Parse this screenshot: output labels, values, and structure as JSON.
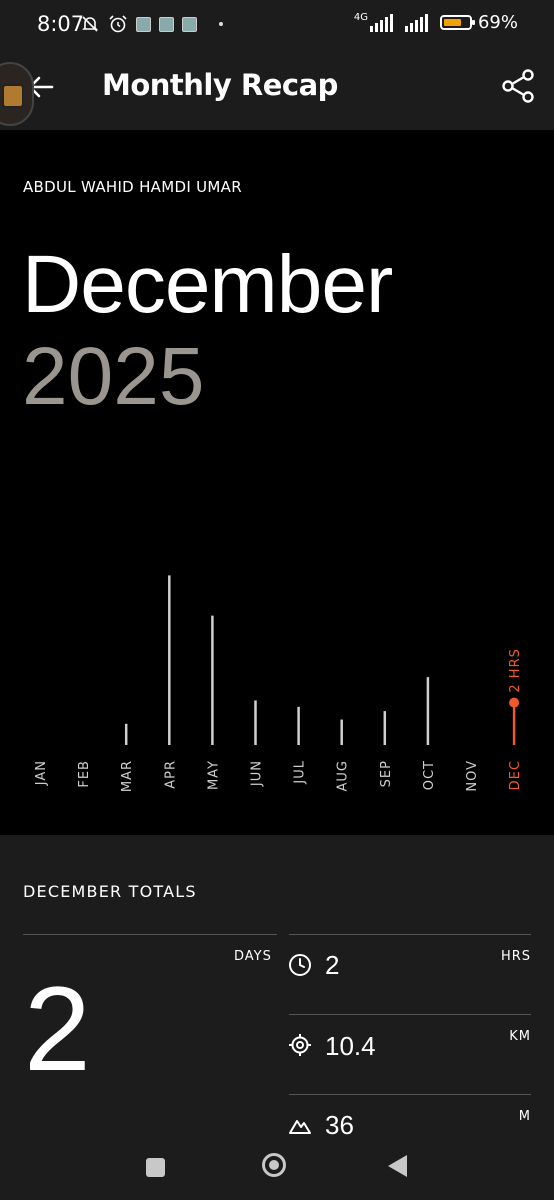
{
  "status_bar": {
    "time": "8:07",
    "network": "4G",
    "battery": "69%",
    "battery_level": 0.69
  },
  "app_bar": {
    "title": "Monthly Recap"
  },
  "recap": {
    "athlete_name": "ABDUL WAHID HAMDI UMAR",
    "month": "December",
    "year": "2025"
  },
  "chart_data": {
    "type": "bar",
    "categories": [
      "JAN",
      "FEB",
      "MAR",
      "APR",
      "MAY",
      "JUN",
      "JUL",
      "AUG",
      "SEP",
      "OCT",
      "NOV",
      "DEC"
    ],
    "values": [
      0,
      0,
      1.0,
      8.0,
      6.1,
      2.1,
      1.8,
      1.2,
      1.6,
      3.2,
      0,
      2
    ],
    "highlight_index": 11,
    "highlight_label": "2 HRS",
    "highlight_color": "#f05a28",
    "bar_color": "#cfcfcf"
  },
  "totals": {
    "title": "DECEMBER TOTALS",
    "days_label": "DAYS",
    "days_value": "2",
    "stats": [
      {
        "icon": "clock-icon",
        "value": "2",
        "unit": "HRS"
      },
      {
        "icon": "target-icon",
        "value": "10.4",
        "unit": "KM"
      },
      {
        "icon": "mountain-icon",
        "value": "36",
        "unit": "M"
      }
    ]
  }
}
